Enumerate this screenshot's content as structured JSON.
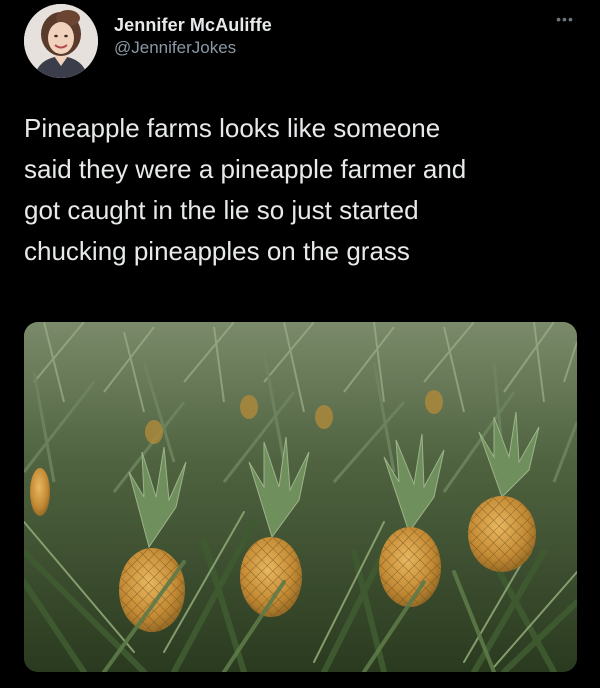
{
  "author": {
    "display_name": "Jennifer McAuliffe",
    "handle": "@JenniferJokes",
    "avatar_icon": "profile-photo"
  },
  "more_icon": "more-dots-icon",
  "tweet": {
    "lines": [
      "Pineapple farms looks like someone",
      "said they were a pineapple farmer and",
      "got caught in the lie so just started",
      "chucking pineapples on the grass"
    ]
  },
  "media": {
    "type": "photo",
    "subject": "pineapple-field"
  },
  "colors": {
    "background": "#000000",
    "text": "#e7e9ea",
    "secondary_text": "#8b98a5"
  }
}
